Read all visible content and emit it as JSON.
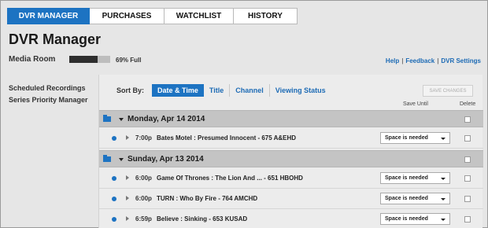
{
  "tabs": [
    {
      "label": "DVR MANAGER",
      "active": true
    },
    {
      "label": "PURCHASES",
      "active": false
    },
    {
      "label": "WATCHLIST",
      "active": false
    },
    {
      "label": "HISTORY",
      "active": false
    }
  ],
  "page_title": "DVR Manager",
  "device": {
    "name": "Media Room",
    "usage_fraction": 0.69,
    "usage_text": "69% Full"
  },
  "links": {
    "help": "Help",
    "sep1": "|",
    "feedback": "Feedback",
    "sep2": "|",
    "settings": "DVR Settings"
  },
  "sidebar": {
    "items": [
      {
        "label": "Scheduled Recordings"
      },
      {
        "label": "Series Priority Manager"
      }
    ]
  },
  "sort": {
    "label": "Sort By:",
    "options": [
      {
        "label": "Date & Time",
        "active": true
      },
      {
        "label": "Title",
        "active": false
      },
      {
        "label": "Channel",
        "active": false
      },
      {
        "label": "Viewing Status",
        "active": false
      }
    ]
  },
  "save_changes_label": "SAVE CHANGES",
  "columns": {
    "save_until": "Save Until",
    "delete": "Delete"
  },
  "groups": [
    {
      "date": "Monday, Apr 14 2014",
      "recordings": [
        {
          "time": "7:00p",
          "title": "Bates Motel : Presumed Innocent - 675 A&EHD",
          "save_until": "Space is needed"
        }
      ]
    },
    {
      "date": "Sunday, Apr 13 2014",
      "recordings": [
        {
          "time": "6:00p",
          "title": "Game Of Thrones : The Lion And ... - 651 HBOHD",
          "save_until": "Space is needed"
        },
        {
          "time": "6:00p",
          "title": "TURN : Who By Fire - 764 AMCHD",
          "save_until": "Space is needed"
        },
        {
          "time": "6:59p",
          "title": "Believe : Sinking - 653 KUSAD",
          "save_until": "Space is needed"
        }
      ]
    }
  ],
  "colors": {
    "accent": "#1d73c2",
    "link": "#1d6bb5",
    "group_bg": "#c4c4c4"
  },
  "icons": {
    "folder": "folder-icon",
    "expand": "caret-down-icon",
    "row_expand": "caret-right-icon",
    "status": "status-dot-icon",
    "dropdown": "chevron-down-icon"
  }
}
